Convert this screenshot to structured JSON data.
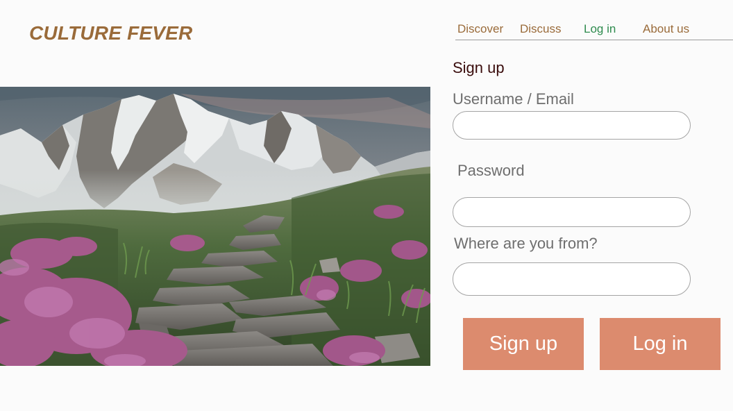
{
  "header": {
    "logo": "CULTURE FEVER",
    "nav": [
      {
        "label": "Discover"
      },
      {
        "label": "Discuss"
      },
      {
        "label": "Log in",
        "active": true
      },
      {
        "label": "About us"
      }
    ]
  },
  "hero": {
    "image": "mountain-path-landscape"
  },
  "form": {
    "title": "Sign up",
    "username_label": "Username / Email",
    "username_value": "",
    "password_label": "Password",
    "password_value": "",
    "origin_label": "Where are you from?",
    "origin_value": "",
    "signup_button": "Sign up",
    "login_button": "Log in"
  },
  "colors": {
    "brand": "#9a6b3a",
    "nav_active": "#2e8b4e",
    "button": "#dc8b6e",
    "title": "#3a0d0d"
  }
}
